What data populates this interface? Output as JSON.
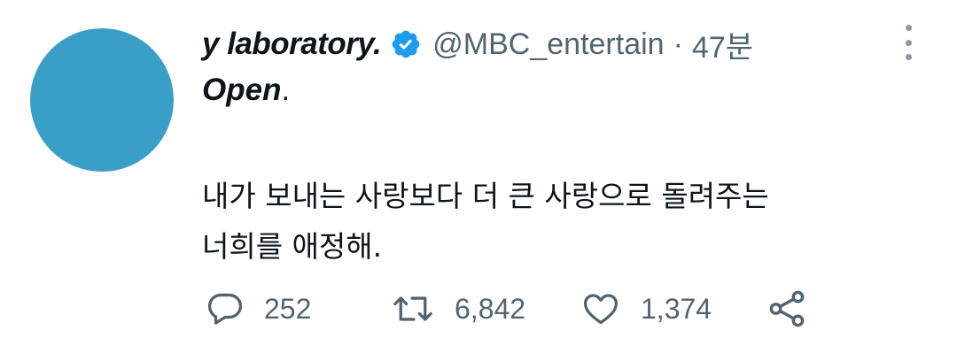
{
  "colors": {
    "avatar": "#3a9fc6",
    "verified": "#1d9bf0",
    "muted": "#536471",
    "text": "#0f1419"
  },
  "tweet": {
    "author_name": "y laboratory.",
    "verified": true,
    "handle": "@MBC_entertain",
    "separator": "·",
    "time": "47분",
    "title_word": "Open",
    "title_dot": ".",
    "body_lines": [
      "내가 보내는 사랑보다 더 큰 사랑으로 돌려주는",
      "너희를 애정해."
    ]
  },
  "actions": {
    "reply": {
      "icon": "reply-icon",
      "count": "252"
    },
    "retweet": {
      "icon": "retweet-icon",
      "count": "6,842"
    },
    "like": {
      "icon": "heart-icon",
      "count": "1,374"
    },
    "share": {
      "icon": "share-icon"
    }
  },
  "menu": {
    "icon": "more-vertical-icon"
  }
}
